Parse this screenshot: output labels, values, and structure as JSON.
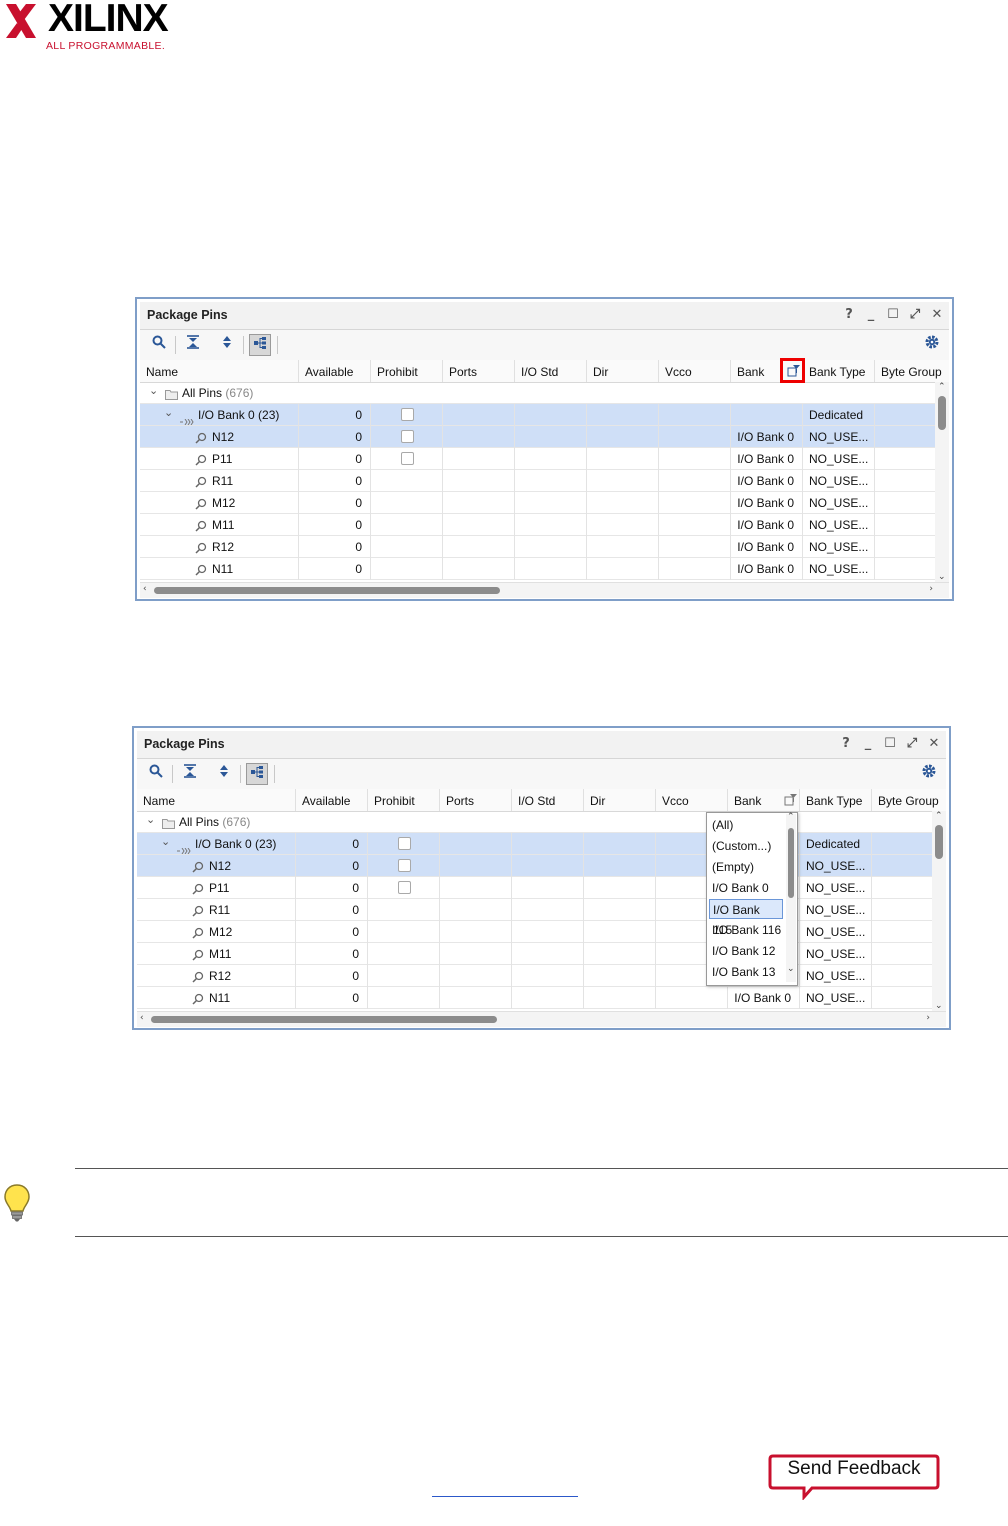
{
  "logo": {
    "brand": "XILINX",
    "tagline": "ALL PROGRAMMABLE."
  },
  "panels": [
    {
      "title": "Package Pins",
      "controls": [
        "?",
        "_",
        "☐",
        "⤢",
        "✕"
      ],
      "columns": [
        "Name",
        "Available",
        "Prohibit",
        "Ports",
        "I/O Std",
        "Dir",
        "Vcco",
        "Bank",
        "Bank Type",
        "Byte Group"
      ],
      "root": {
        "label": "All Pins",
        "count": "(676)"
      },
      "group": {
        "label": "I/O Bank 0 (23)",
        "available": "0",
        "bank_type": "Dedicated"
      },
      "rows": [
        {
          "name": "N12",
          "available": "0",
          "bank": "I/O Bank 0",
          "bank_type": "NO_USE..."
        },
        {
          "name": "P11",
          "available": "0",
          "bank": "I/O Bank 0",
          "bank_type": "NO_USE..."
        },
        {
          "name": "R11",
          "available": "0",
          "bank": "I/O Bank 0",
          "bank_type": "NO_USE..."
        },
        {
          "name": "M12",
          "available": "0",
          "bank": "I/O Bank 0",
          "bank_type": "NO_USE..."
        },
        {
          "name": "M11",
          "available": "0",
          "bank": "I/O Bank 0",
          "bank_type": "NO_USE..."
        },
        {
          "name": "R12",
          "available": "0",
          "bank": "I/O Bank 0",
          "bank_type": "NO_USE..."
        },
        {
          "name": "N11",
          "available": "0",
          "bank": "I/O Bank 0",
          "bank_type": "NO_USE..."
        }
      ]
    },
    {
      "title": "Package Pins",
      "controls": [
        "?",
        "_",
        "☐",
        "⤢",
        "✕"
      ],
      "columns": [
        "Name",
        "Available",
        "Prohibit",
        "Ports",
        "I/O Std",
        "Dir",
        "Vcco",
        "Bank",
        "Bank Type",
        "Byte Group"
      ],
      "root": {
        "label": "All Pins",
        "count": "(676)"
      },
      "group": {
        "label": "I/O Bank 0 (23)",
        "available": "0",
        "bank_type": "Dedicated"
      },
      "rows": [
        {
          "name": "N12",
          "available": "0",
          "bank": "",
          "bank_type": "NO_USE..."
        },
        {
          "name": "P11",
          "available": "0",
          "bank": "",
          "bank_type": "NO_USE..."
        },
        {
          "name": "R11",
          "available": "0",
          "bank": "",
          "bank_type": "NO_USE..."
        },
        {
          "name": "M12",
          "available": "0",
          "bank": "",
          "bank_type": "NO_USE..."
        },
        {
          "name": "M11",
          "available": "0",
          "bank": "",
          "bank_type": "NO_USE..."
        },
        {
          "name": "R12",
          "available": "0",
          "bank": "",
          "bank_type": "NO_USE..."
        },
        {
          "name": "N11",
          "available": "0",
          "bank": "I/O Bank 0",
          "bank_type": "NO_USE..."
        }
      ],
      "filter_options": [
        "(All)",
        "(Custom...)",
        "(Empty)",
        "I/O Bank 0",
        "I/O Bank 115",
        "I/O Bank 116",
        "I/O Bank 12",
        "I/O Bank 13"
      ],
      "filter_highlighted": "I/O Bank 115"
    }
  ],
  "feedback": {
    "label": "Send Feedback"
  },
  "colors": {
    "selected_row": "#cfdff7",
    "highlight_box": "#ee0000",
    "brand_red": "#c8102e"
  }
}
